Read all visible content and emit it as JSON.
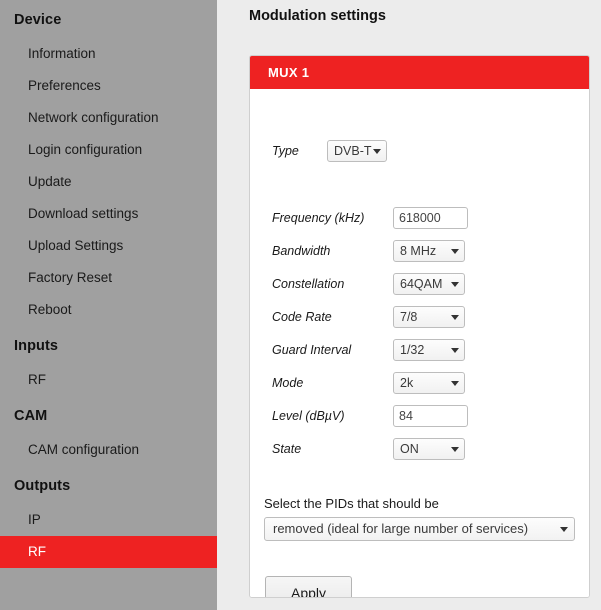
{
  "colors": {
    "accent_red": "#ee2222",
    "sidebar_gray": "#a0a0a0",
    "page_background": "#ececec",
    "panel_white": "#ffffff"
  },
  "sidebar": {
    "groups": [
      {
        "title": "Device",
        "items": [
          {
            "label": "Information",
            "active": false
          },
          {
            "label": "Preferences",
            "active": false
          },
          {
            "label": "Network configuration",
            "active": false
          },
          {
            "label": "Login configuration",
            "active": false
          },
          {
            "label": "Update",
            "active": false
          },
          {
            "label": "Download settings",
            "active": false
          },
          {
            "label": "Upload Settings",
            "active": false
          },
          {
            "label": "Factory Reset",
            "active": false
          },
          {
            "label": "Reboot",
            "active": false
          }
        ]
      },
      {
        "title": "Inputs",
        "items": [
          {
            "label": "RF",
            "active": false
          }
        ]
      },
      {
        "title": "CAM",
        "items": [
          {
            "label": "CAM configuration",
            "active": false
          }
        ]
      },
      {
        "title": "Outputs",
        "items": [
          {
            "label": "IP",
            "active": false
          },
          {
            "label": "RF",
            "active": true
          }
        ]
      }
    ],
    "active_marker_icon": "left-triangle-icon"
  },
  "main": {
    "page_title": "Modulation settings",
    "panel": {
      "header": "MUX 1",
      "type_row": {
        "label": "Type",
        "value": "DVB-T",
        "control": "select",
        "arrow_icon": "chevron-down-icon"
      },
      "fields": [
        {
          "label": "Frequency (kHz)",
          "value": "618000",
          "control": "text"
        },
        {
          "label": "Bandwidth",
          "value": "8 MHz",
          "control": "select"
        },
        {
          "label": "Constellation",
          "value": "64QAM",
          "control": "select"
        },
        {
          "label": "Code Rate",
          "value": "7/8",
          "control": "select"
        },
        {
          "label": "Guard Interval",
          "value": "1/32",
          "control": "select"
        },
        {
          "label": "Mode",
          "value": "2k",
          "control": "select"
        },
        {
          "label": "Level (dBµV)",
          "value": "84",
          "control": "text"
        },
        {
          "label": "State",
          "value": "ON",
          "control": "select"
        }
      ],
      "pid": {
        "label": "Select the PIDs that should be",
        "value": "removed (ideal for large number of services)",
        "arrow_icon": "chevron-down-icon"
      },
      "apply_label": "Apply"
    }
  }
}
